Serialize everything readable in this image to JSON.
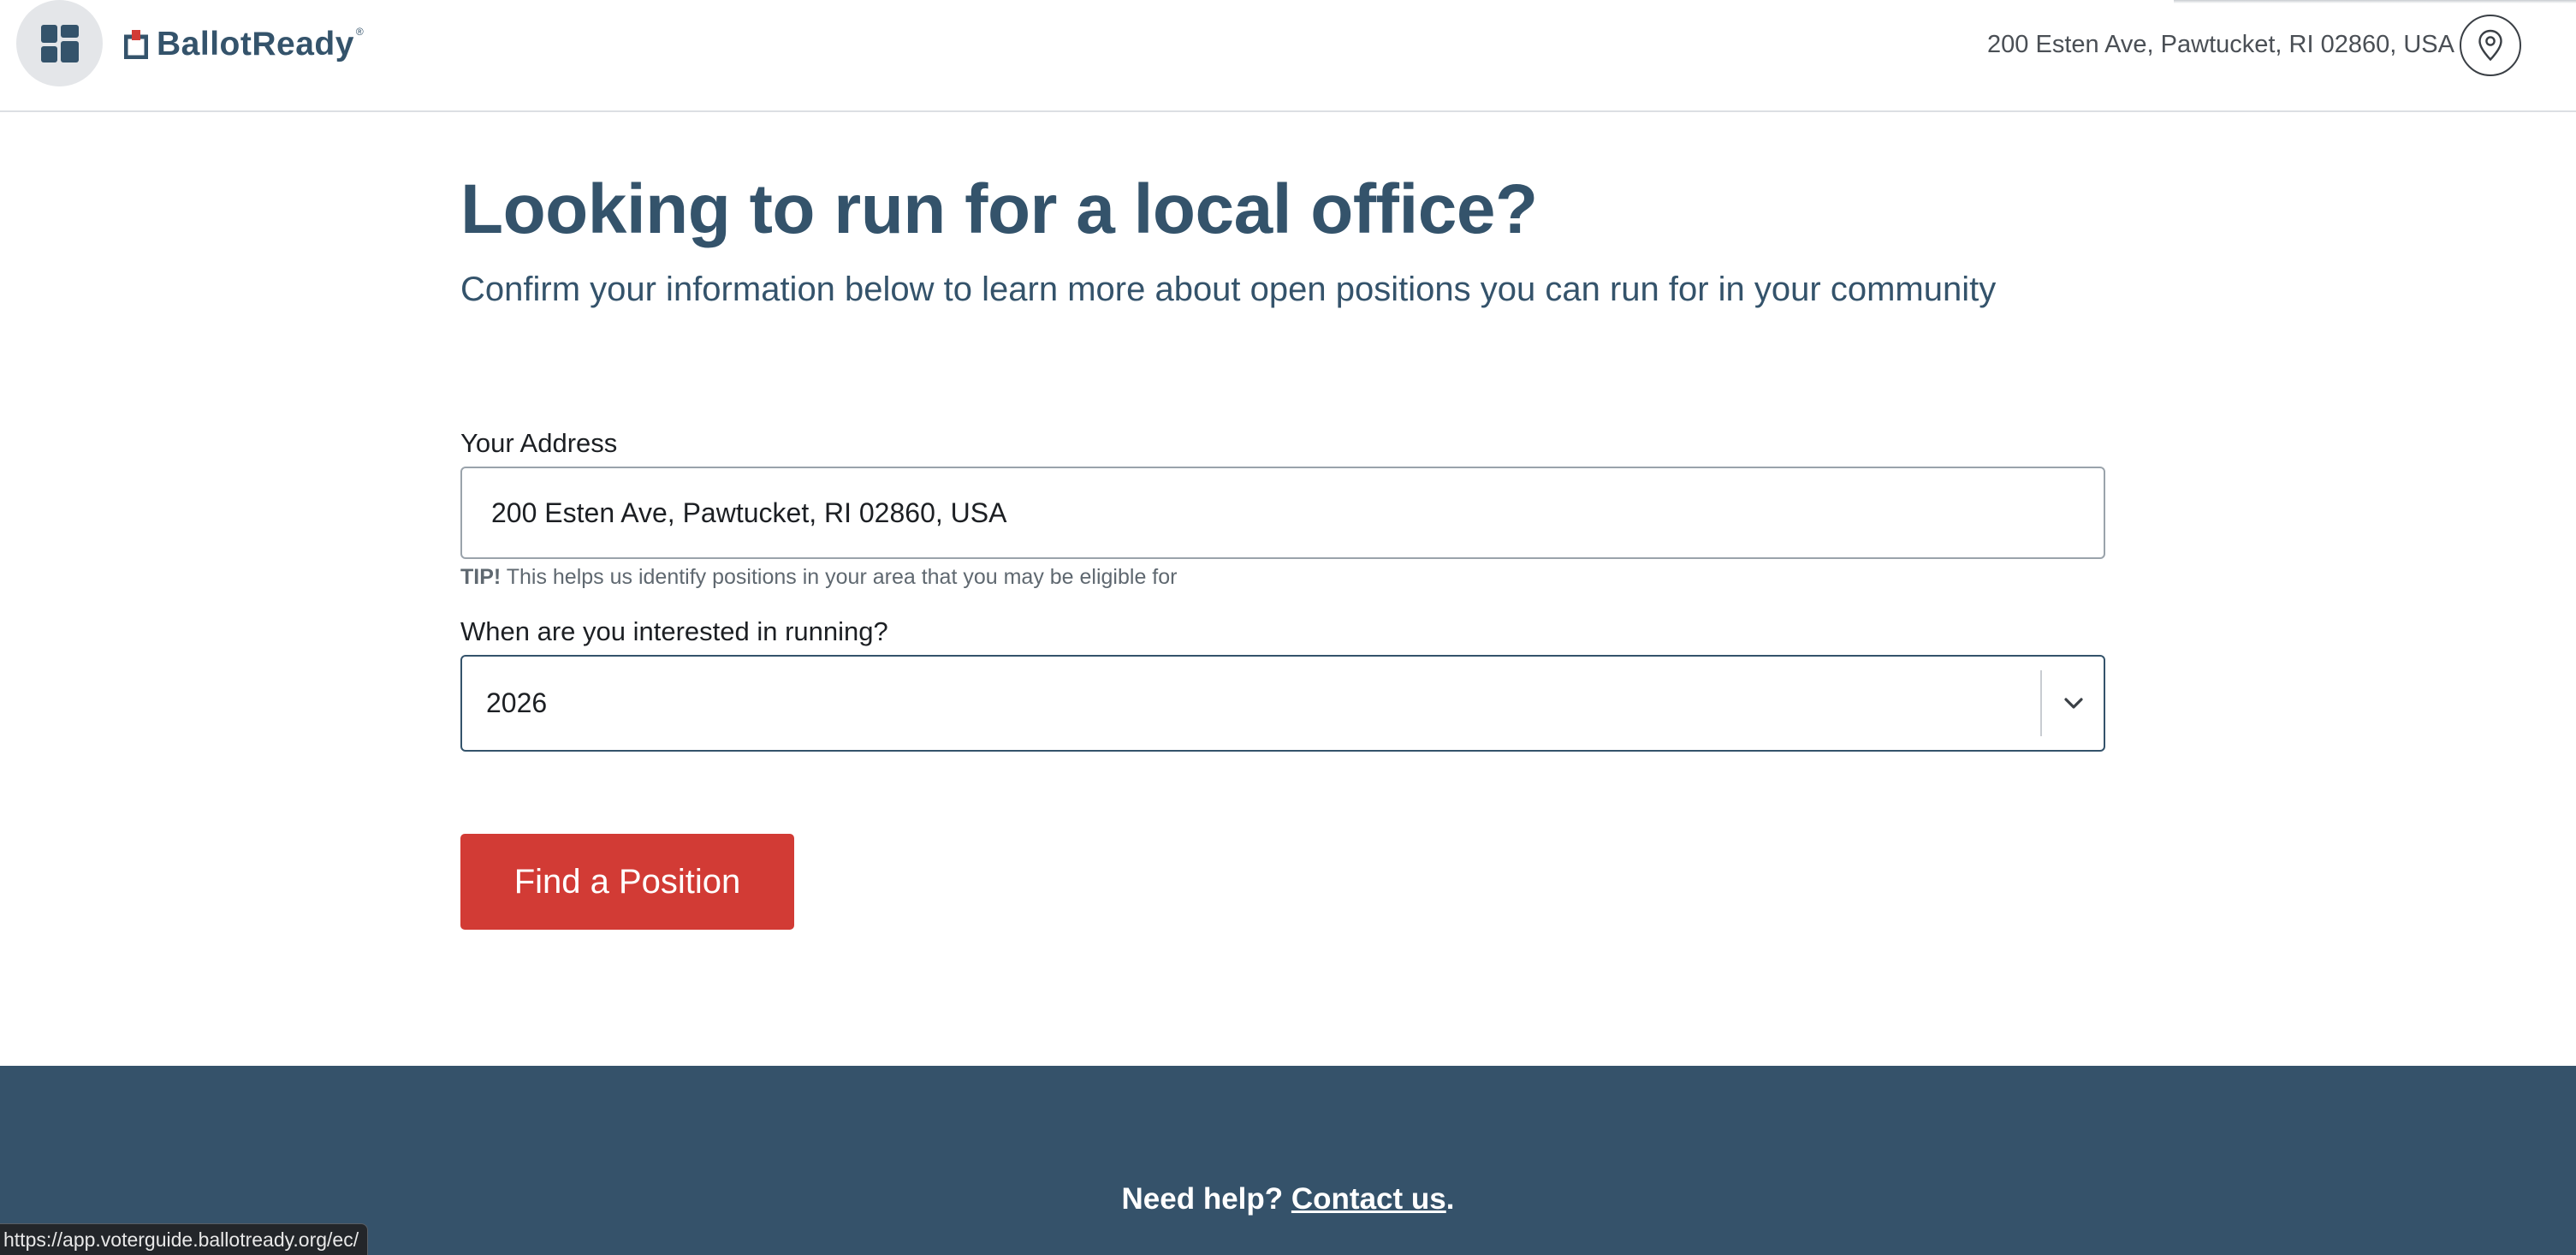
{
  "header": {
    "logo_text": "BallotReady",
    "logo_reg_mark": "®",
    "address": "200 Esten Ave, Pawtucket, RI 02860, USA",
    "menu_icon": "grid-icon",
    "location_icon": "map-pin-icon"
  },
  "main": {
    "title": "Looking to run for a local office?",
    "subtitle": "Confirm your information below to learn more about open positions you can run for in your community",
    "address_field": {
      "label": "Your Address",
      "value": "200 Esten Ave, Pawtucket, RI 02860, USA",
      "tip_strong": "TIP!",
      "tip_text": "This helps us identify positions in your area that you may be eligible for"
    },
    "when_field": {
      "label": "When are you interested in running?",
      "selected": "2026",
      "icon": "chevron-down-icon"
    },
    "submit_label": "Find a Position"
  },
  "footer": {
    "help_text": "Need help?",
    "contact_link": "Contact us",
    "trailing": "."
  },
  "status_bar": {
    "url": "https://app.voterguide.ballotready.org/ec/"
  },
  "colors": {
    "brand_navy": "#34536b",
    "accent_red": "#d23b35",
    "footer_bg": "#35526a"
  }
}
